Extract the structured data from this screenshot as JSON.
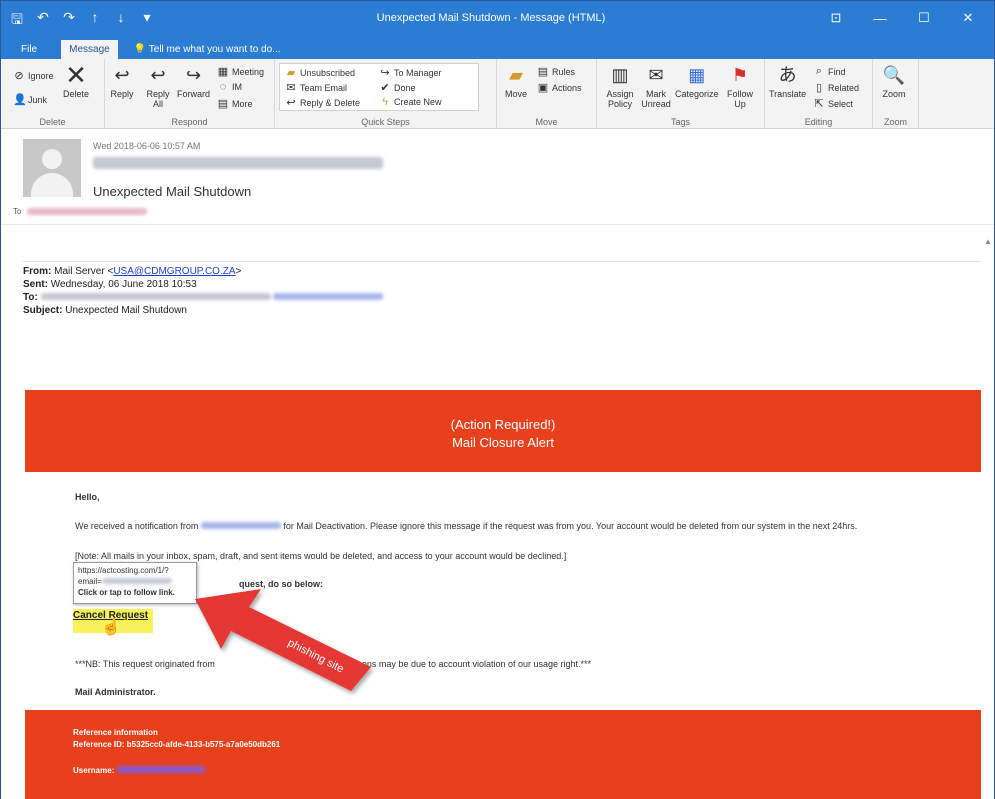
{
  "window": {
    "title": "Unexpected Mail Shutdown - Message (HTML)",
    "controls": [
      "⊡",
      "—",
      "☐",
      "✕"
    ]
  },
  "qat": [
    "🖫",
    "↶",
    "↷",
    "↑",
    "↓",
    "▾"
  ],
  "tabs": [
    {
      "label": "File"
    },
    {
      "label": "Message"
    }
  ],
  "tell_me": "Tell me what you want to do...",
  "ribbon": {
    "delete_group": {
      "label": "Delete",
      "ignore": "Ignore",
      "junk": "Junk",
      "delete": "Delete"
    },
    "respond_group": {
      "label": "Respond",
      "reply": "Reply",
      "reply_all": "Reply All",
      "forward": "Forward",
      "meeting": "Meeting",
      "im": "IM",
      "more": "More"
    },
    "quick_steps_group": {
      "label": "Quick Steps",
      "items": [
        "Unsubscribed",
        "Team Email",
        "Reply & Delete",
        "To Manager",
        "Done",
        "Create New"
      ]
    },
    "move_group": {
      "label": "Move",
      "move": "Move",
      "rules": "Rules",
      "actions": "Actions"
    },
    "tags_group": {
      "label": "Tags",
      "assign_policy": "Assign Policy",
      "mark_unread": "Mark Unread",
      "categorize": "Categorize",
      "follow_up": "Follow Up"
    },
    "editing_group": {
      "label": "Editing",
      "translate": "Translate",
      "find": "Find",
      "related": "Related",
      "select": "Select"
    },
    "zoom_group": {
      "label": "Zoom",
      "zoom": "Zoom"
    }
  },
  "message": {
    "date": "Wed 2018-06-06 10:57 AM",
    "subject": "Unexpected Mail Shutdown",
    "to_label": "To"
  },
  "forwarded": {
    "from_label": "From:",
    "from_name": "Mail Server <",
    "from_email": "USA@CDMGROUP.CO.ZA",
    "from_close": ">",
    "sent_label": "Sent:",
    "sent_value": "Wednesday, 06 June 2018 10:53",
    "to_label": "To:",
    "subject_label": "Subject:",
    "subject_value": "Unexpected Mail Shutdown"
  },
  "email": {
    "banner_line1": "(Action Required!)",
    "banner_line2": "Mail Closure Alert",
    "hello": "Hello,",
    "notice_start": "We received a notification from",
    "notice_end": "for Mail Deactivation. Please ignore this message if the request was from you. Your account would be deleted from our system in the next 24hrs.",
    "note": "[Note: All mails in your inbox, spam, draft, and sent items would be deleted, and access to your account would be declined.]",
    "instruction": "quest, do so below:",
    "cancel_link": "Cancel Request",
    "nb_start": "***NB: This request originated from",
    "nb_end": "d reasons may be due to account violation of our usage right.***",
    "signature": "Mail Administrator.",
    "ref_title": "Reference information",
    "ref_id": "Reference ID: b5325cc0-afde-4133-b575-a7a0e50db261",
    "username_label": "Username:"
  },
  "tooltip": {
    "url": "https://actcosting.com/1/?",
    "email_label": "email=",
    "hint": "Click or tap to follow link."
  },
  "annotation": {
    "label": "phishing site",
    "color": "#e53935"
  },
  "colors": {
    "banner": "#e8401c",
    "titlebar": "#2b7cd3",
    "highlight": "#f7f25a"
  }
}
